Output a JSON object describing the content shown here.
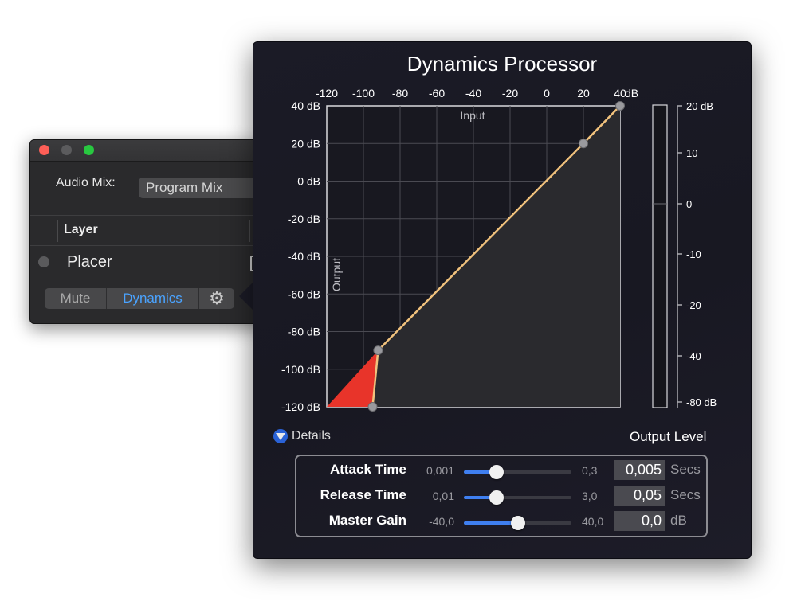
{
  "window": {
    "audio_mix_label": "Audio Mix:",
    "audio_mix_value": "Program Mix",
    "layer_header": "Layer",
    "layer_name": "Placer",
    "buttons": {
      "mute": "Mute",
      "dynamics": "Dynamics"
    },
    "gear_icon": "gear-icon"
  },
  "popover": {
    "title": "Dynamics Processor",
    "details_label": "Details",
    "output_level_label": "Output Level",
    "graph": {
      "x_axis_name": "Input",
      "y_axis_name": "Output",
      "x_ticks": [
        "-120",
        "-100",
        "-80",
        "-60",
        "-40",
        "-20",
        "0",
        "20",
        "40"
      ],
      "x_unit": "dB",
      "y_ticks": [
        "40 dB",
        "20 dB",
        "0 dB",
        "-20 dB",
        "-40 dB",
        "-60 dB",
        "-80 dB",
        "-100 dB",
        "-120 dB"
      ],
      "curve_points_db": [
        [
          -120,
          -120
        ],
        [
          -95,
          -120
        ],
        [
          -92,
          -90
        ],
        [
          20,
          20
        ],
        [
          40,
          40
        ]
      ],
      "gate_color": "#e8342a",
      "curve_color": "#f1c27d"
    },
    "meter": {
      "ticks": [
        "20 dB",
        "10",
        "0",
        "-10",
        "-20",
        "-40",
        "-80 dB"
      ]
    },
    "params": [
      {
        "label": "Attack Time",
        "min": "0,001",
        "max": "0,3",
        "value": "0,005",
        "unit": "Secs",
        "fraction": 0.3
      },
      {
        "label": "Release Time",
        "min": "0,01",
        "max": "3,0",
        "value": "0,05",
        "unit": "Secs",
        "fraction": 0.3
      },
      {
        "label": "Master Gain",
        "min": "-40,0",
        "max": "40,0",
        "value": "0,0",
        "unit": "dB",
        "fraction": 0.5
      }
    ]
  }
}
